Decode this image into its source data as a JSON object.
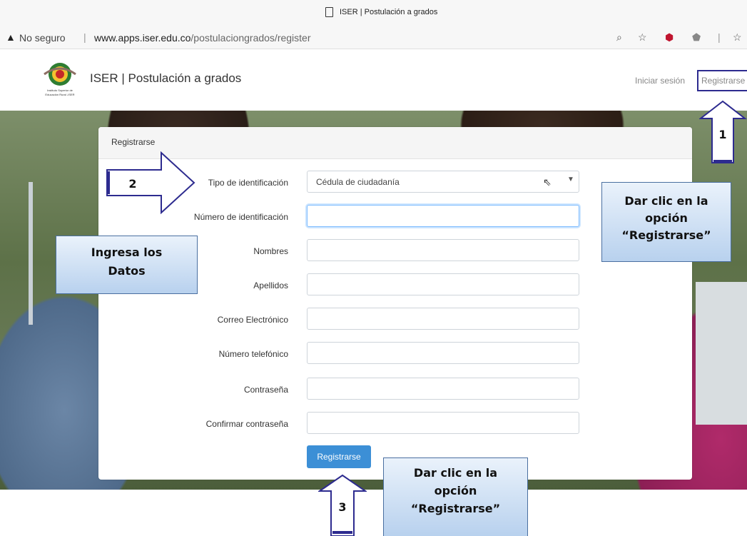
{
  "browser": {
    "tab_title": "ISER | Postulación a grados",
    "security_label": "No seguro",
    "url_domain": "www.apps.iser.edu.co",
    "url_path": "/postulaciongrados/register"
  },
  "header": {
    "brand": "ISER | Postulación a grados",
    "logo_text": "Instituto Superior de Educación Rural -ISER",
    "nav_login": "Iniciar sesión",
    "nav_register": "Registrarse"
  },
  "form": {
    "title": "Registrarse",
    "fields": [
      {
        "label": "Tipo de identificación",
        "value": "Cédula de ciudadanía"
      },
      {
        "label": "Número de identificación",
        "value": ""
      },
      {
        "label": "Nombres",
        "value": ""
      },
      {
        "label": "Apellidos",
        "value": ""
      },
      {
        "label": "Correo Electrónico",
        "value": ""
      },
      {
        "label": "Número telefónico",
        "value": ""
      },
      {
        "label": "Contraseña",
        "value": ""
      },
      {
        "label": "Confirmar contraseña",
        "value": ""
      }
    ],
    "submit_label": "Registrarse"
  },
  "annotations": {
    "step1_number": "1",
    "step2_number": "2",
    "step3_number": "3",
    "callout_register_top_line1": "Dar clic en la",
    "callout_register_top_line2": "opción",
    "callout_register_top_line3": "“Registrarse”",
    "callout_data_line1": "Ingresa los",
    "callout_data_line2": "Datos",
    "callout_register_bottom_line1": "Dar clic en la",
    "callout_register_bottom_line2": "opción",
    "callout_register_bottom_line3": "“Registrarse”"
  },
  "colors": {
    "annotation_border": "#2d2b8f",
    "primary_button": "#3c8fd6"
  }
}
